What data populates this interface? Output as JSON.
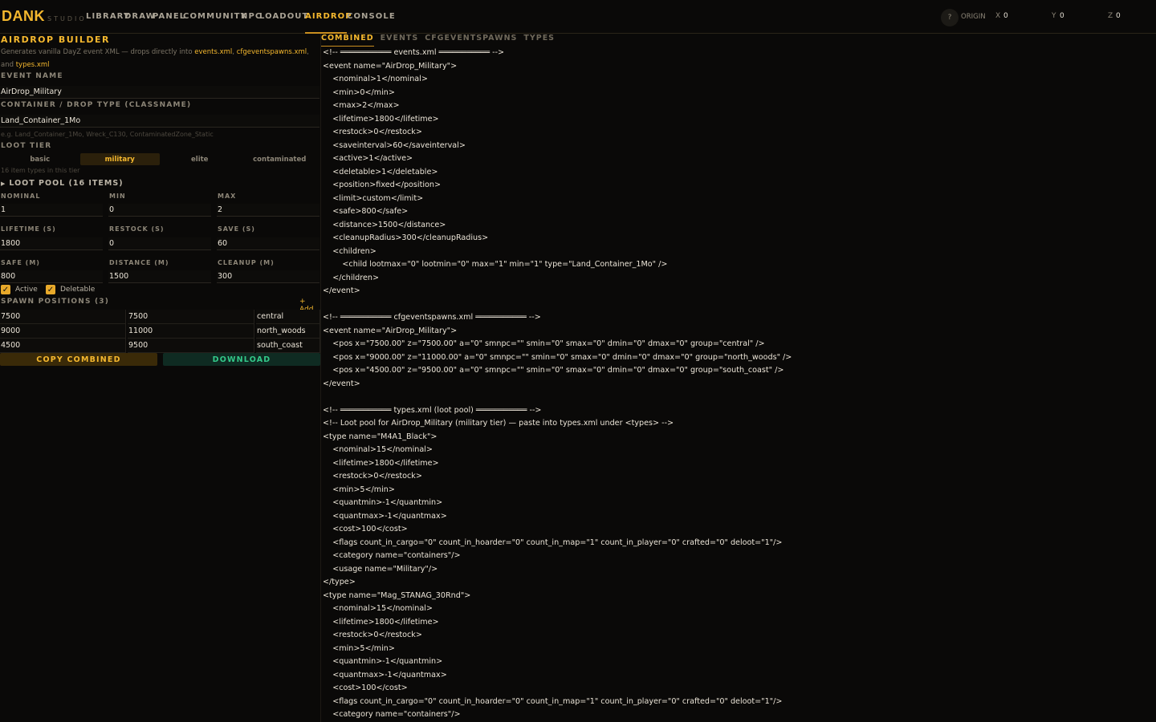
{
  "app": {
    "logo": "DANK",
    "logo_sub": "STUDIO"
  },
  "nav": {
    "items": [
      "LIBRARY",
      "DRAW",
      "PANEL",
      "COMMUNITY",
      "NPC",
      "LOADOUT",
      "AIRDROP",
      "CONSOLE"
    ],
    "active": "AIRDROP",
    "help": "?",
    "origin_label": "ORIGIN",
    "x_label": "X",
    "x_value": "0",
    "y_label": "Y",
    "y_value": "0",
    "z_label": "Z",
    "z_value": "0"
  },
  "builder": {
    "title": "AIRDROP BUILDER",
    "desc_prefix": "Generates vanilla DayZ event XML — drops directly into ",
    "desc_file1": "events.xml",
    "desc_sep": ", ",
    "desc_file2": "cfgeventspawns.xml",
    "desc_and": ", and ",
    "desc_file3": "types.xml",
    "event_name_label": "EVENT NAME",
    "event_name_value": "AirDrop_Military",
    "container_label": "CONTAINER / DROP TYPE (CLASSNAME)",
    "container_value": "Land_Container_1Mo",
    "container_hint": "e.g. Land_Container_1Mo, Wreck_C130, ContaminatedZone_Static",
    "loot_tier_label": "LOOT TIER",
    "tiers": [
      "basic",
      "military",
      "elite",
      "contaminated"
    ],
    "active_tier": "military",
    "tier_hint": "16 item types in this tier",
    "loot_pool_label": "LOOT POOL (16 ITEMS)",
    "nominal_label": "NOMINAL",
    "nominal_value": "1",
    "min_label": "MIN",
    "min_value": "0",
    "max_label": "MAX",
    "max_value": "2",
    "lifetime_label": "LIFETIME (S)",
    "lifetime_value": "1800",
    "restock_label": "RESTOCK (S)",
    "restock_value": "0",
    "save_label": "SAVE (S)",
    "save_value": "60",
    "safe_label": "SAFE (M)",
    "safe_value": "800",
    "distance_label": "DISTANCE (M)",
    "distance_value": "1500",
    "cleanup_label": "CLEANUP (M)",
    "cleanup_value": "300",
    "active_label": "Active",
    "deletable_label": "Deletable",
    "check_mark": "✓",
    "spawn_label": "SPAWN POSITIONS (3)",
    "add_label": "+ Add",
    "spawns": [
      {
        "x": "7500",
        "z": "7500",
        "group": "central"
      },
      {
        "x": "9000",
        "z": "11000",
        "group": "north_woods"
      },
      {
        "x": "4500",
        "z": "9500",
        "group": "south_coast"
      }
    ],
    "copy_label": "COPY COMBINED",
    "download_label": "DOWNLOAD"
  },
  "output": {
    "tabs": [
      "COMBINED",
      "EVENTS",
      "CFGEVENTSPAWNS",
      "TYPES"
    ],
    "active_tab": "COMBINED",
    "code": "<!-- ═══════════ events.xml ═══════════ -->\n<event name=\"AirDrop_Military\">\n    <nominal>1</nominal>\n    <min>0</min>\n    <max>2</max>\n    <lifetime>1800</lifetime>\n    <restock>0</restock>\n    <saveinterval>60</saveinterval>\n    <active>1</active>\n    <deletable>1</deletable>\n    <position>fixed</position>\n    <limit>custom</limit>\n    <safe>800</safe>\n    <distance>1500</distance>\n    <cleanupRadius>300</cleanupRadius>\n    <children>\n        <child lootmax=\"0\" lootmin=\"0\" max=\"1\" min=\"1\" type=\"Land_Container_1Mo\" />\n    </children>\n</event>\n\n<!-- ═══════════ cfgeventspawns.xml ═══════════ -->\n<event name=\"AirDrop_Military\">\n    <pos x=\"7500.00\" z=\"7500.00\" a=\"0\" smnpc=\"\" smin=\"0\" smax=\"0\" dmin=\"0\" dmax=\"0\" group=\"central\" />\n    <pos x=\"9000.00\" z=\"11000.00\" a=\"0\" smnpc=\"\" smin=\"0\" smax=\"0\" dmin=\"0\" dmax=\"0\" group=\"north_woods\" />\n    <pos x=\"4500.00\" z=\"9500.00\" a=\"0\" smnpc=\"\" smin=\"0\" smax=\"0\" dmin=\"0\" dmax=\"0\" group=\"south_coast\" />\n</event>\n\n<!-- ═══════════ types.xml (loot pool) ═══════════ -->\n<!-- Loot pool for AirDrop_Military (military tier) — paste into types.xml under <types> -->\n<type name=\"M4A1_Black\">\n    <nominal>15</nominal>\n    <lifetime>1800</lifetime>\n    <restock>0</restock>\n    <min>5</min>\n    <quantmin>-1</quantmin>\n    <quantmax>-1</quantmax>\n    <cost>100</cost>\n    <flags count_in_cargo=\"0\" count_in_hoarder=\"0\" count_in_map=\"1\" count_in_player=\"0\" crafted=\"0\" deloot=\"1\"/>\n    <category name=\"containers\"/>\n    <usage name=\"Military\"/>\n</type>\n<type name=\"Mag_STANAG_30Rnd\">\n    <nominal>15</nominal>\n    <lifetime>1800</lifetime>\n    <restock>0</restock>\n    <min>5</min>\n    <quantmin>-1</quantmin>\n    <quantmax>-1</quantmax>\n    <cost>100</cost>\n    <flags count_in_cargo=\"0\" count_in_hoarder=\"0\" count_in_map=\"1\" count_in_player=\"0\" crafted=\"0\" deloot=\"1\"/>\n    <category name=\"containers\"/>"
  },
  "colors": {
    "accent": "#f5b82e",
    "background": "#0a0908",
    "download": "#33c98a"
  }
}
